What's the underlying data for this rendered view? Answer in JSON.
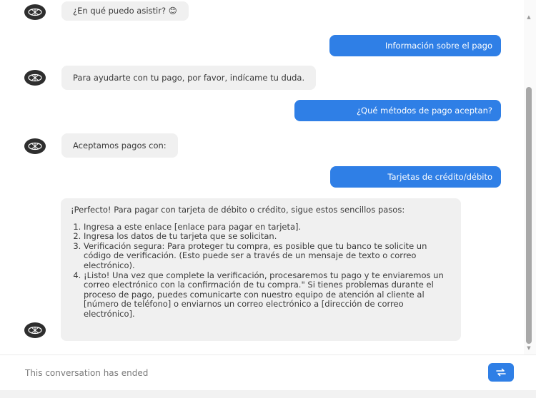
{
  "messages": [
    {
      "role": "bot",
      "text": "¿En qué puedo asistir? 😊"
    },
    {
      "role": "user",
      "text": "Información sobre el pago"
    },
    {
      "role": "bot",
      "text": "Para ayudarte con tu pago, por favor, indícame tu duda."
    },
    {
      "role": "user",
      "text": "¿Qué métodos de pago aceptan?"
    },
    {
      "role": "bot",
      "text": "Aceptamos pagos con:"
    },
    {
      "role": "user",
      "text": "Tarjetas de crédito/débito"
    }
  ],
  "long_message": {
    "intro": "¡Perfecto! Para pagar con tarjeta de débito o crédito, sigue estos sencillos pasos:",
    "steps": [
      "Ingresa a este enlace [enlace para pagar en tarjeta].",
      "Ingresa los datos de tu tarjeta que se solicitan.",
      "Verificación segura: Para proteger tu compra, es posible que tu banco te solicite un código de verificación. (Esto puede ser a través de un mensaje de texto o correo electrónico).",
      "¡Listo! Una vez que complete la verificación, procesaremos tu pago y te enviaremos un correo electrónico con la confirmación de tu compra.\" Si tienes problemas durante el proceso de pago, puedes comunicarte con nuestro equipo de atención al cliente al [número de teléfono] o enviarnos un correo electrónico a [dirección de correo electrónico]."
    ]
  },
  "footer": {
    "status_text": "This conversation has ended"
  },
  "colors": {
    "user_bubble": "#2f7fe6",
    "bot_bubble": "#f0f0f0"
  },
  "icons": {
    "avatar": "bot-avatar-icon",
    "restart": "restart-arrows-icon"
  }
}
